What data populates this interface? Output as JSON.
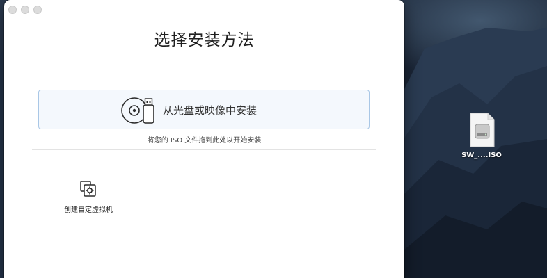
{
  "window": {
    "title": "选择安装方法"
  },
  "install_option": {
    "label": "从光盘或映像中安装",
    "hint": "将您的 ISO 文件拖到此处以开始安装"
  },
  "create_vm": {
    "label": "创建自定虚拟机"
  },
  "desktop": {
    "file_label": "SW_....ISO"
  },
  "colors": {
    "accent_border": "#a9c7e6",
    "accent_fill": "#f4f8fd"
  },
  "icons": {
    "install": "disc-usb-icon",
    "create": "custom-vm-icon",
    "file": "iso-file-icon"
  }
}
